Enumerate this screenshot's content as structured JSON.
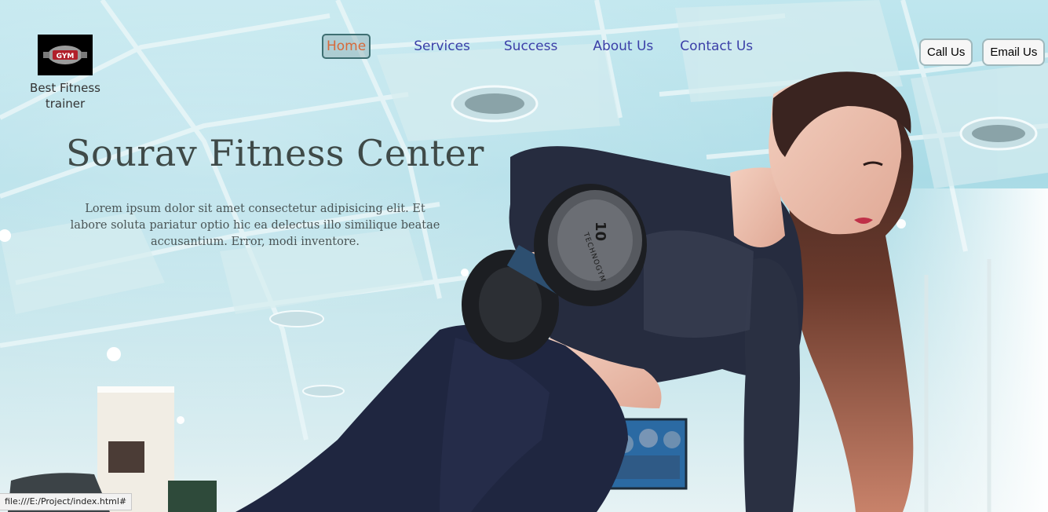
{
  "brand": {
    "logo_icon": "gym-logo-icon",
    "logo_text": "GYM",
    "tagline": "Best Fitness trainer"
  },
  "nav": {
    "items": [
      {
        "label": "Home",
        "active": true
      },
      {
        "label": "Services"
      },
      {
        "label": "Success"
      },
      {
        "label": "About Us"
      },
      {
        "label": "Contact Us"
      }
    ]
  },
  "contact_buttons": {
    "call_label": "Call Us",
    "email_label": "Email Us"
  },
  "hero": {
    "title": "Sourav Fitness Center",
    "description": "Lorem ipsum dolor sit amet consectetur adipisicing elit. Et labore soluta pariatur optio hic ea delectus illo similique beatae accusantium. Error, modi inventore.",
    "image_icon": "woman-lifting-dumbbell-photo",
    "dumbbell_number": "10",
    "dumbbell_brand": "TECHNOGYM"
  },
  "status_bar": {
    "url": "file:///E:/Project/index.html#"
  },
  "colors": {
    "nav_link": "#3b3fa8",
    "nav_active": "#d7693a",
    "title_text": "#3f4a48"
  }
}
